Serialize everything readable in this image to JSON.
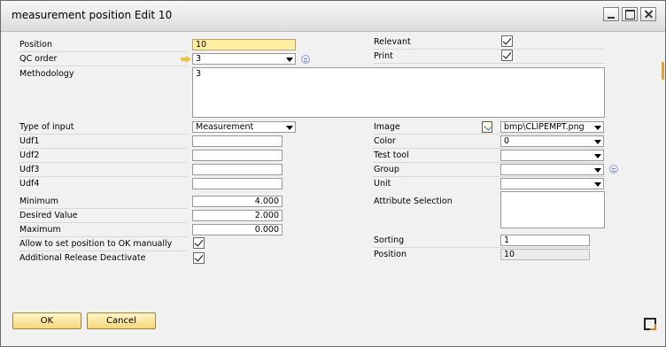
{
  "window": {
    "title": "measurement position Edit 10"
  },
  "left": {
    "position_label": "Position",
    "position_value": "10",
    "qc_order_label": "QC order",
    "qc_order_value": "3",
    "methodology_label": "Methodology",
    "methodology_value": "3",
    "type_of_input_label": "Type of input",
    "type_of_input_value": "Measurement",
    "udf1_label": "Udf1",
    "udf1_value": "",
    "udf2_label": "Udf2",
    "udf2_value": "",
    "udf3_label": "Udf3",
    "udf3_value": "",
    "udf4_label": "Udf4",
    "udf4_value": "",
    "minimum_label": "Minimum",
    "minimum_value": "4.000",
    "desired_label": "Desired Value",
    "desired_value": "2.000",
    "maximum_label": "Maximum",
    "maximum_value": "0.000",
    "allow_ok_label": "Allow to set position to OK manually",
    "allow_ok_checked": true,
    "release_label": "Additional Release Deactivate",
    "release_checked": true
  },
  "right": {
    "relevant_label": "Relevant",
    "relevant_checked": true,
    "print_label": "Print",
    "print_checked": true,
    "image_label": "Image",
    "image_value": "bmp\\CLIPEMPT.png",
    "color_label": "Color",
    "color_value": "0",
    "test_tool_label": "Test tool",
    "test_tool_value": "",
    "group_label": "Group",
    "group_value": "",
    "unit_label": "Unit",
    "unit_value": "",
    "attribute_label": "Attribute Selection",
    "attribute_value": "",
    "sorting_label": "Sorting",
    "sorting_value": "1",
    "position_label": "Position",
    "position_value": "10"
  },
  "buttons": {
    "ok": "OK",
    "cancel": "Cancel"
  },
  "icons": {
    "link_arrow": "golden-arrow-icon",
    "info": "info-icon",
    "image_picker": "image-edit-icon",
    "resize": "resize-icon"
  }
}
